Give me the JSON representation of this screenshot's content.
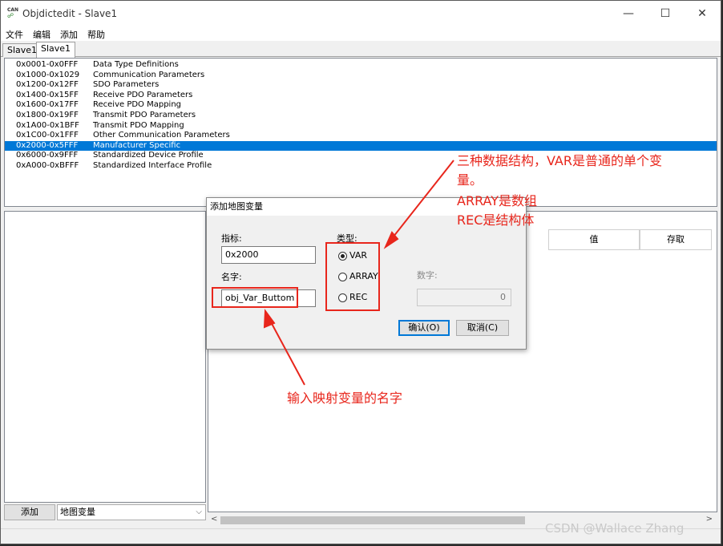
{
  "window": {
    "title": "Objdictedit - Slave1",
    "icon_top": "CAN",
    "icon_bottom": "☍",
    "controls": {
      "minimize": "—",
      "maximize": "☐",
      "close": "✕"
    }
  },
  "menu": [
    "文件",
    "编辑",
    "添加",
    "帮助"
  ],
  "tabs": [
    "Slave1",
    "Slave1"
  ],
  "index_list": [
    {
      "range": "0x0001-0x0FFF",
      "name": "Data Type Definitions"
    },
    {
      "range": "0x1000-0x1029",
      "name": "Communication Parameters"
    },
    {
      "range": "0x1200-0x12FF",
      "name": "SDO Parameters"
    },
    {
      "range": "0x1400-0x15FF",
      "name": "Receive PDO Parameters"
    },
    {
      "range": "0x1600-0x17FF",
      "name": "Receive PDO Mapping"
    },
    {
      "range": "0x1800-0x19FF",
      "name": "Transmit PDO Parameters"
    },
    {
      "range": "0x1A00-0x1BFF",
      "name": "Transmit PDO Mapping"
    },
    {
      "range": "0x1C00-0x1FFF",
      "name": "Other Communication Parameters"
    },
    {
      "range": "0x2000-0x5FFF",
      "name": "Manufacturer Specific",
      "selected": true
    },
    {
      "range": "0x6000-0x9FFF",
      "name": "Standardized Device Profile"
    },
    {
      "range": "0xA000-0xBFFF",
      "name": "Standardized Interface Profile"
    }
  ],
  "bottom_left": {
    "add_button": "添加",
    "select_value": "地图变量",
    "chevron": "⌵"
  },
  "grid": {
    "columns": [
      "值",
      "存取"
    ]
  },
  "scroll": {
    "left": "<",
    "right": ">"
  },
  "dialog": {
    "title": "添加地图变量",
    "index_label": "指标:",
    "index_value": "0x2000",
    "name_label": "名字:",
    "name_value": "obj_Var_Buttom",
    "type_label": "类型:",
    "types": [
      "VAR",
      "ARRAY",
      "REC"
    ],
    "selected_type": "VAR",
    "number_label": "数字:",
    "number_value": "0",
    "ok_button": "确认(O)",
    "cancel_button": "取消(C)"
  },
  "annotations": {
    "types_note_line1": "三种数据结构，VAR是普通的单个变",
    "types_note_line2": "量。",
    "types_note_line3": "ARRAY是数组",
    "types_note_line4": "REC是结构体",
    "name_note": "输入映射变量的名字",
    "color": "#e8261c"
  },
  "watermark": "CSDN @Wallace Zhang"
}
